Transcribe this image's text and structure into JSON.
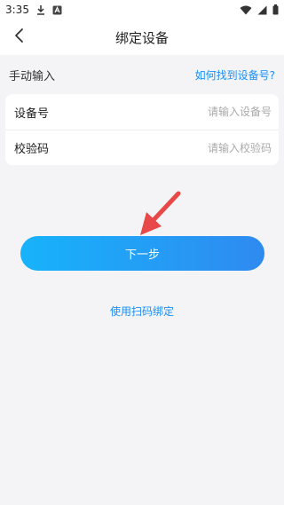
{
  "status_bar": {
    "time": "3:35"
  },
  "nav": {
    "title": "绑定设备"
  },
  "section": {
    "title": "手动输入",
    "help_link": "如何找到设备号?"
  },
  "form": {
    "device_label": "设备号",
    "device_placeholder": "请输入设备号",
    "code_label": "校验码",
    "code_placeholder": "请输入校验码"
  },
  "actions": {
    "next_label": "下一步",
    "scan_label": "使用扫码绑定"
  },
  "colors": {
    "accent": "#1a8ef5",
    "button_gradient_start": "#17b3fb",
    "button_gradient_end": "#2f8af0",
    "arrow": "#e84848"
  },
  "icons": {
    "back": "chevron-left-icon",
    "download": "download-icon",
    "notification": "a-notification-icon",
    "wifi": "wifi-icon",
    "signal": "signal-icon",
    "battery": "battery-icon",
    "annotation": "red-arrow-icon"
  }
}
